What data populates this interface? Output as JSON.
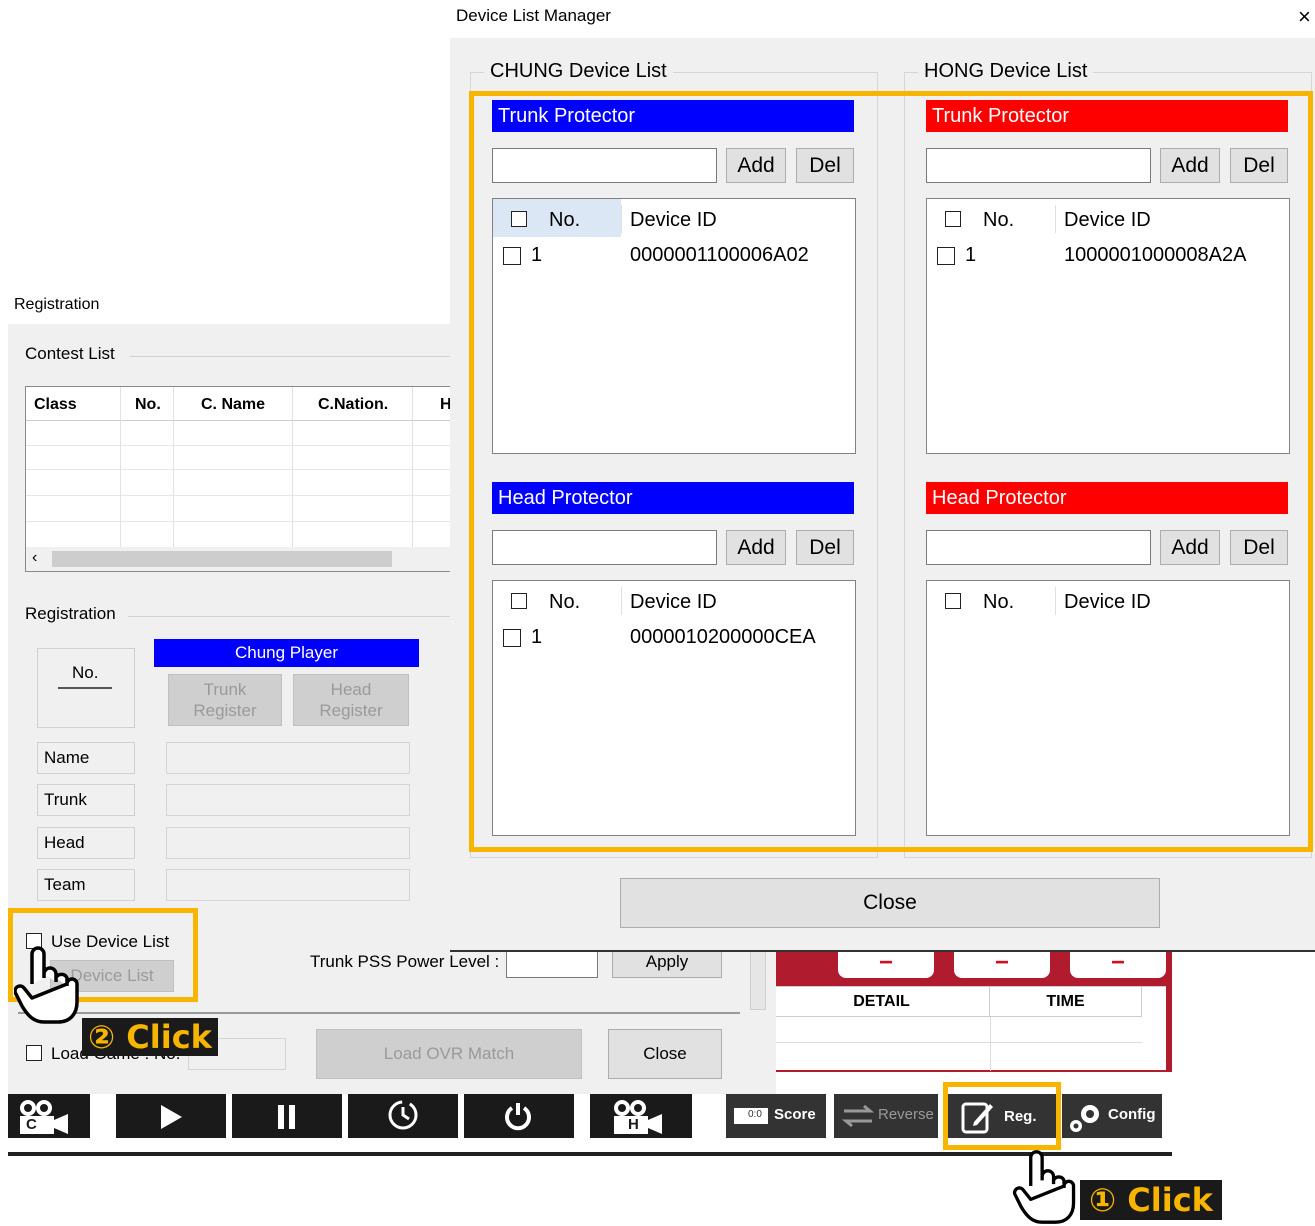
{
  "registration": {
    "title": "Registration",
    "contest_list_label": "Contest List",
    "columns": [
      "Class",
      "No.",
      "C. Name",
      "C.Nation.",
      "H"
    ],
    "registration_label": "Registration",
    "no_label": "No.",
    "chung_player": "Chung Player",
    "trunk_register": [
      "Trunk",
      "Register"
    ],
    "head_register": [
      "Head",
      "Register"
    ],
    "fields": [
      "Name",
      "Trunk",
      "Head",
      "Team"
    ],
    "use_device_list": "Use Device List",
    "device_list_button": "Device List",
    "trunk_pss_label": "Trunk PSS Power Level :",
    "apply": "Apply",
    "load_game_no": "Load Game : No.",
    "load_ovr_match": "Load OVR Match",
    "close": "Close"
  },
  "background_app": {
    "detail_col": "DETAIL",
    "time_col": "TIME",
    "minus": "−",
    "toolbar": {
      "score": "Score",
      "reverse": "Reverse",
      "reg": "Reg.",
      "config": "Config",
      "score_badge": "0:0",
      "c_badge": "C",
      "h_badge": "H"
    }
  },
  "device_manager": {
    "title": "Device List Manager",
    "close_x": "×",
    "chung_group": "CHUNG Device List",
    "hong_group": "HONG Device List",
    "trunk_protector": "Trunk Protector",
    "head_protector": "Head Protector",
    "add": "Add",
    "del": "Del",
    "col_no": "No.",
    "col_device_id": "Device ID",
    "chung_trunk_rows": [
      {
        "no": "1",
        "id": "0000001100006A02"
      }
    ],
    "hong_trunk_rows": [
      {
        "no": "1",
        "id": "1000001000008A2A"
      }
    ],
    "chung_head_rows": [
      {
        "no": "1",
        "id": "0000010200000CEA"
      }
    ],
    "hong_head_rows": [],
    "close": "Close"
  },
  "annotations": {
    "step1": "① Click",
    "step2": "② Click"
  },
  "colors": {
    "chung": "#0000ff",
    "hong": "#ff0000",
    "highlight": "#f7b500"
  }
}
